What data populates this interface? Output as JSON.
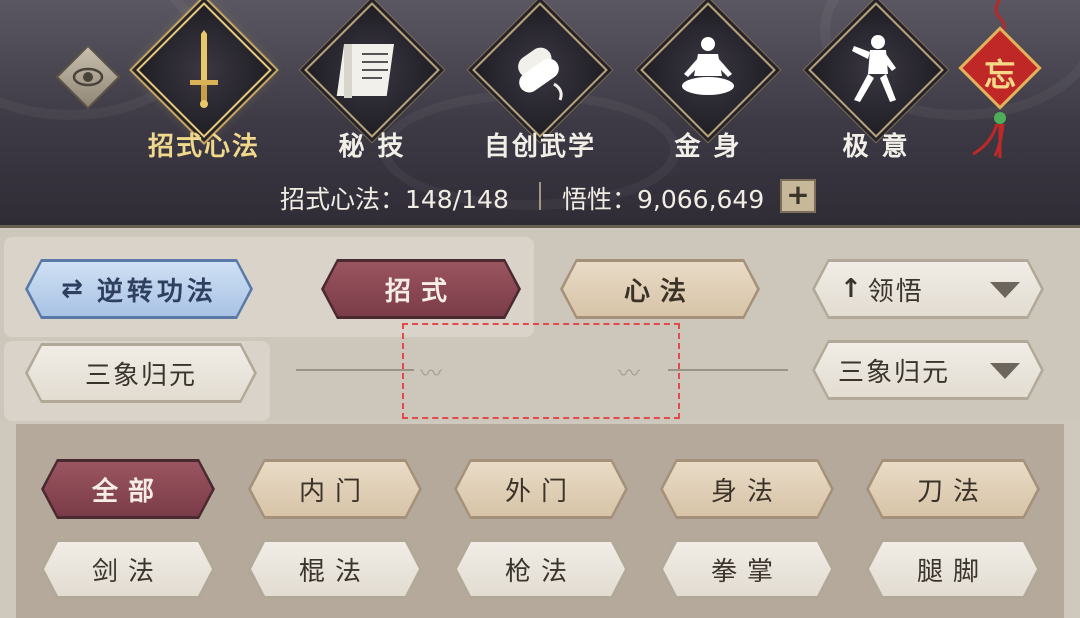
{
  "tabs": [
    {
      "label": "招式心法",
      "icon": "sword-icon",
      "active": true
    },
    {
      "label": "秘 技",
      "icon": "scroll-book-icon",
      "active": false
    },
    {
      "label": "自创武学",
      "icon": "rolled-scroll-icon",
      "active": false
    },
    {
      "label": "金 身",
      "icon": "meditation-icon",
      "active": false
    },
    {
      "label": "极 意",
      "icon": "martial-stance-icon",
      "active": false
    }
  ],
  "charm": {
    "char": "忘"
  },
  "stats": {
    "moves_label": "招式心法：148/148",
    "insight_label": "悟性：9,066,649",
    "plus": "+"
  },
  "controls": {
    "reverse": "逆转功法",
    "moves": "招式",
    "method": "心法",
    "sort": "领悟",
    "sort_arrow": "↑",
    "stance": "三象归元",
    "stance_select": "三象归元"
  },
  "categories": [
    "全部",
    "内门",
    "外门",
    "身法",
    "刀法",
    "剑法",
    "棍法",
    "枪法",
    "拳掌",
    "腿脚"
  ],
  "colors": {
    "accent_gold": "#f0d88c",
    "active_red": "#8a4652",
    "blue": "#a9c3e4"
  }
}
